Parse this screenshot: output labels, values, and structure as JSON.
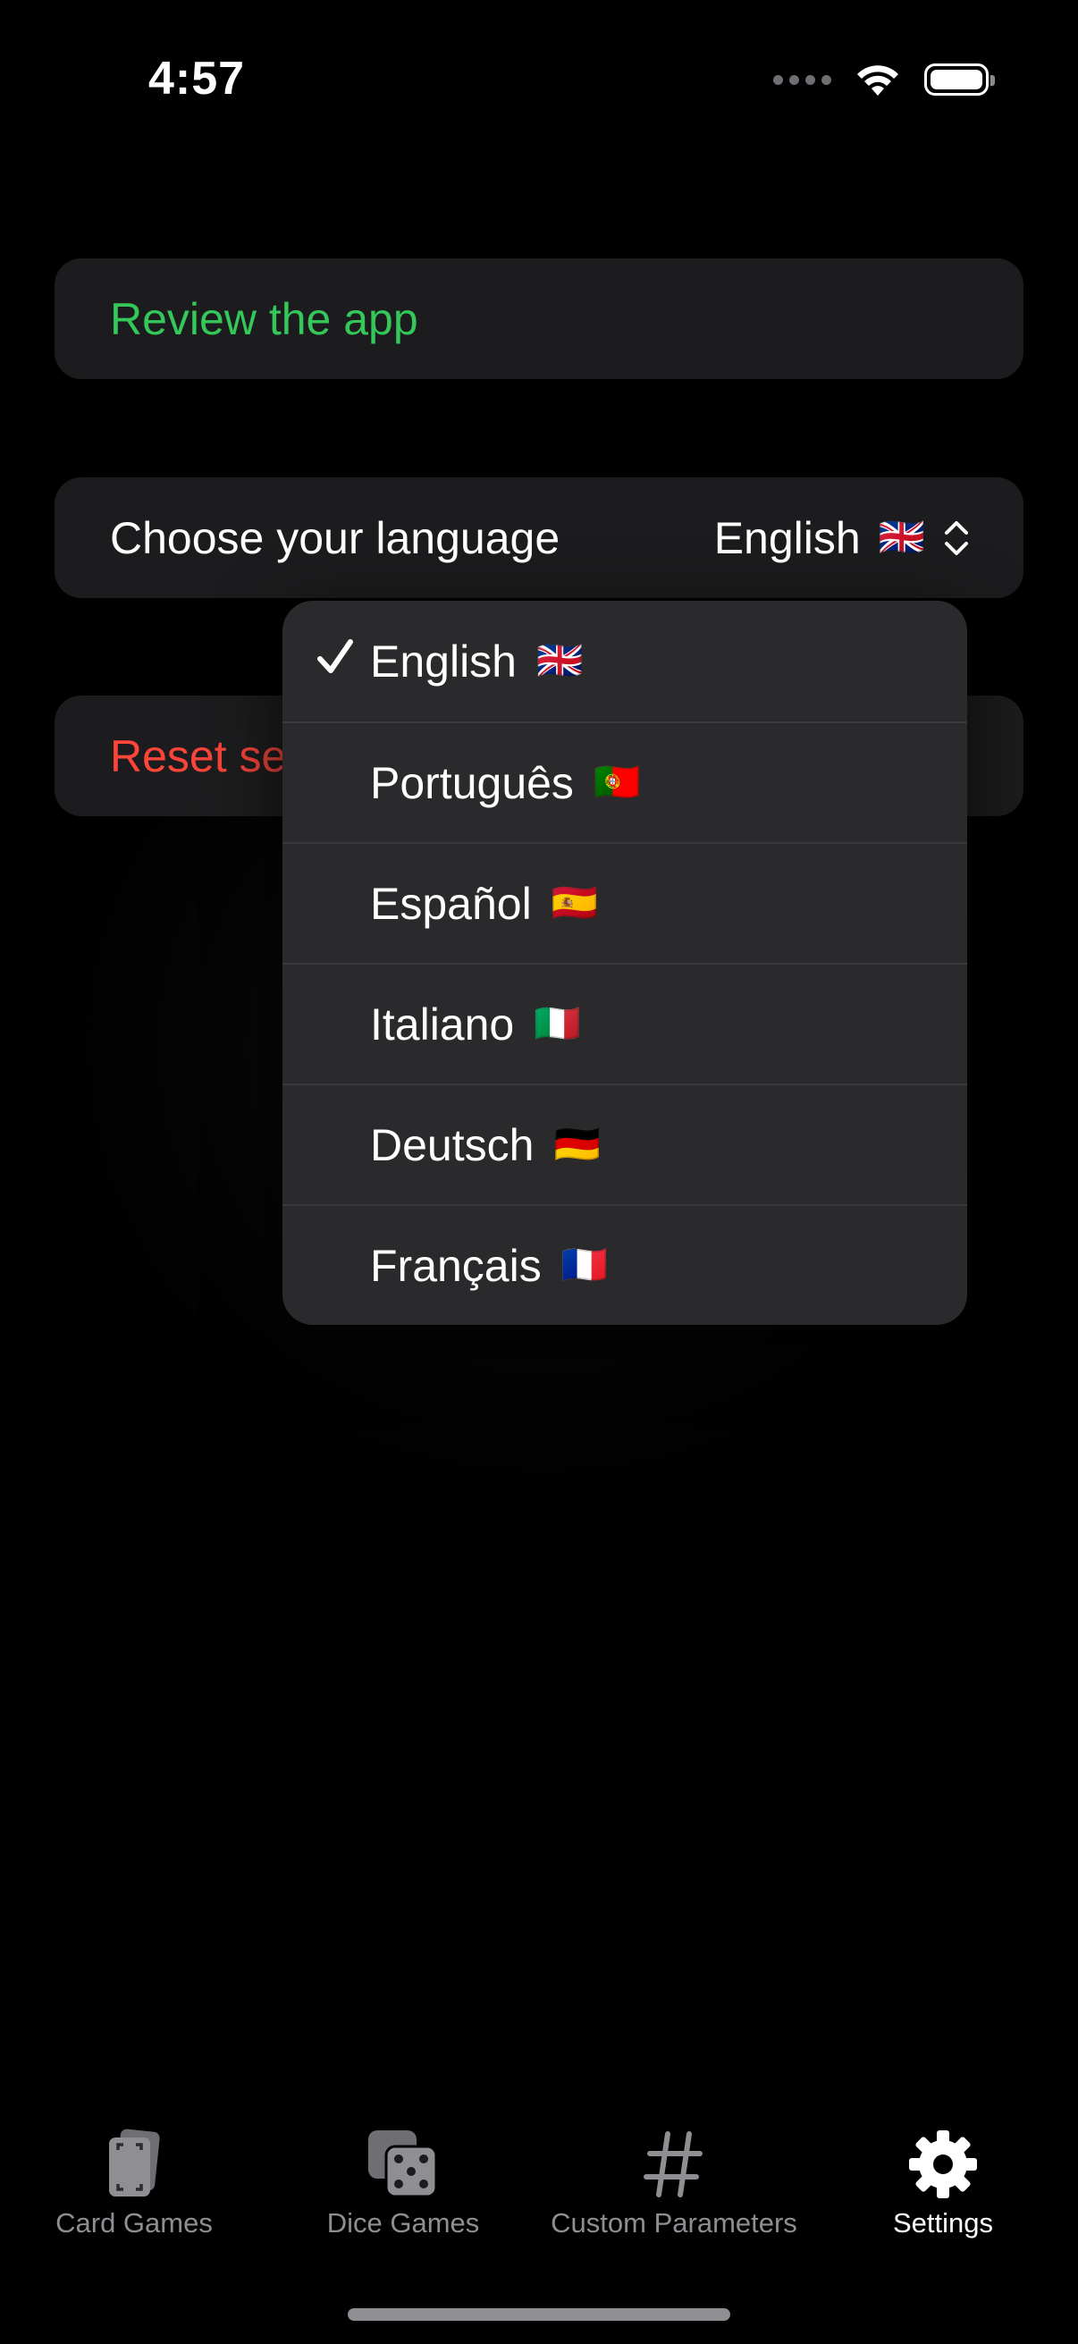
{
  "status": {
    "time": "4:57"
  },
  "settings": {
    "review_label": "Review the app",
    "language_label": "Choose your language",
    "language_value": "English",
    "language_value_flag": "🇬🇧",
    "reset_label": "Reset se"
  },
  "language_menu": {
    "items": [
      {
        "label": "English",
        "flag": "🇬🇧",
        "selected": true
      },
      {
        "label": "Português",
        "flag": "🇵🇹",
        "selected": false
      },
      {
        "label": "Español",
        "flag": "🇪🇸",
        "selected": false
      },
      {
        "label": "Italiano",
        "flag": "🇮🇹",
        "selected": false
      },
      {
        "label": "Deutsch",
        "flag": "🇩🇪",
        "selected": false
      },
      {
        "label": "Français",
        "flag": "🇫🇷",
        "selected": false
      }
    ]
  },
  "tabbar": {
    "tabs": [
      {
        "label": "Card Games",
        "icon": "cards-icon",
        "active": false
      },
      {
        "label": "Dice Games",
        "icon": "dice-icon",
        "active": false
      },
      {
        "label": "Custom Parameters",
        "icon": "number-sign-icon",
        "active": false
      },
      {
        "label": "Settings",
        "icon": "gear-icon",
        "active": true
      }
    ]
  },
  "colors": {
    "review": "#34c759",
    "reset": "#ff453a",
    "row_bg": "#1c1c1e",
    "menu_bg": "#2a2a2c",
    "tab_inactive": "#8e8e93",
    "tab_active": "#ffffff"
  }
}
